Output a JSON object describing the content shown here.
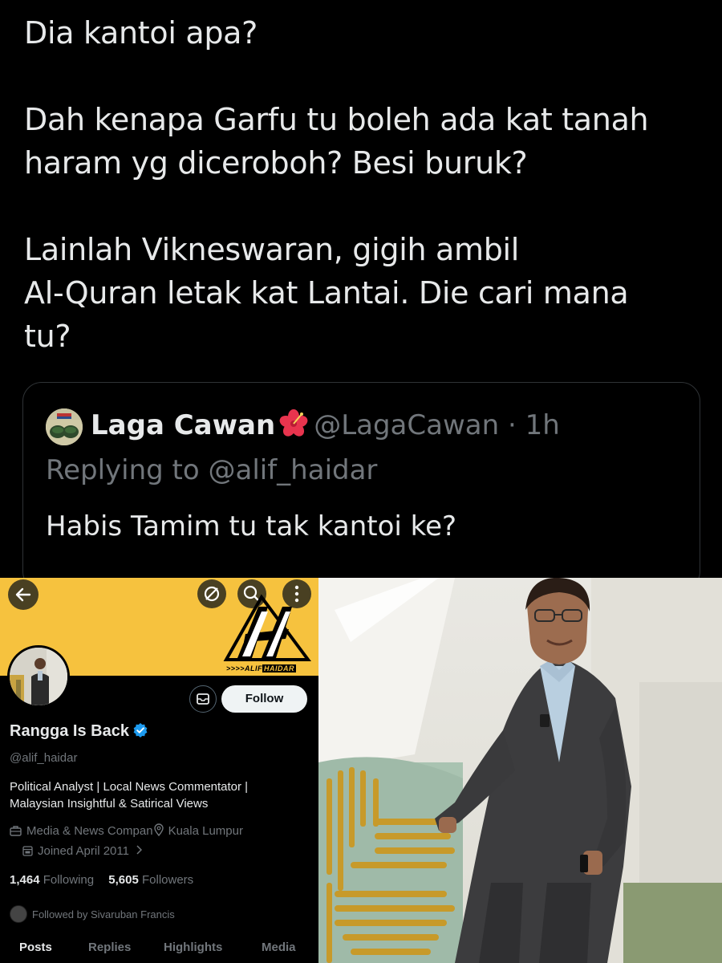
{
  "tweet": {
    "paragraphs": [
      "Dia kantoi apa?",
      "Dah kenapa Garfu tu boleh ada kat tanah\nharam yg diceroboh? Besi buruk?",
      "Lainlah Vikneswaran, gigih ambil\nAl-Quran letak kat Lantai. Die cari mana\ntu?"
    ],
    "quote": {
      "name": "Laga Cawan",
      "handle_time": "@LagaCawan · 1h",
      "replying": "Replying to @alif_haidar",
      "body": "Habis Tamim tu tak kantoi ke?"
    }
  },
  "profile": {
    "banner_logo_a": ">>>>ALIF",
    "banner_logo_b": "HAIDAR",
    "follow_label": "Follow",
    "name": "Rangga Is Back",
    "handle": "@alif_haidar",
    "bio_line1": "Political Analyst | Local News Commentator |",
    "bio_line2": "Malaysian Insightful & Satirical Views",
    "category": "Media & News Compan",
    "location": "Kuala Lumpur",
    "joined": "Joined April 2011",
    "following_count": "1,464",
    "following_label": "Following",
    "followers_count": "5,605",
    "followers_label": "Followers",
    "followed_by": "Followed by Sivaruban Francis",
    "tabs": [
      "Posts",
      "Replies",
      "Highlights",
      "Media"
    ]
  },
  "colors": {
    "background": "#000000",
    "text": "#e7e9ea",
    "muted": "#71767b",
    "banner": "#f6c23e",
    "verified": "#1d9bf0",
    "border": "#2f3336"
  },
  "icons": [
    "back-arrow-icon",
    "no-notifications-icon",
    "search-icon",
    "more-icon",
    "message-icon",
    "verified-icon",
    "briefcase-icon",
    "location-icon",
    "calendar-icon",
    "chevron-right-icon",
    "hibiscus-icon"
  ]
}
